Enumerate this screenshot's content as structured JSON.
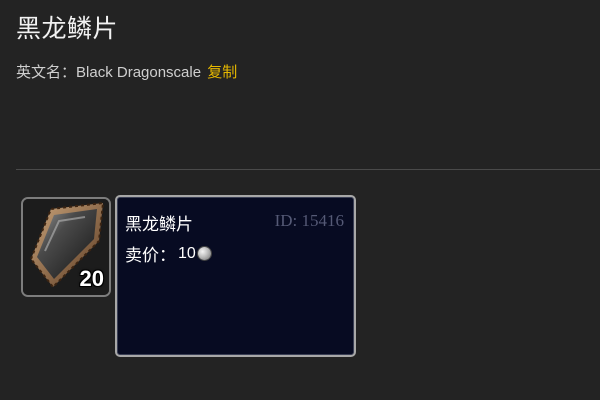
{
  "item": {
    "title": "黑龙鳞片",
    "english_label": "英文名：",
    "english_name": "Black Dragonscale",
    "copy_label": "复制",
    "icon": "black-dragonscale-icon",
    "stack_count": "20"
  },
  "tooltip": {
    "name": "黑龙鳞片",
    "id_text": "ID: 15416",
    "price_label": "卖价：",
    "price_value": "10",
    "currency_icon": "silver-coin-icon"
  },
  "colors": {
    "background": "#232323",
    "copy_link": "#e6b800",
    "tooltip_bg": "#070b22",
    "id_text": "#555a76"
  }
}
